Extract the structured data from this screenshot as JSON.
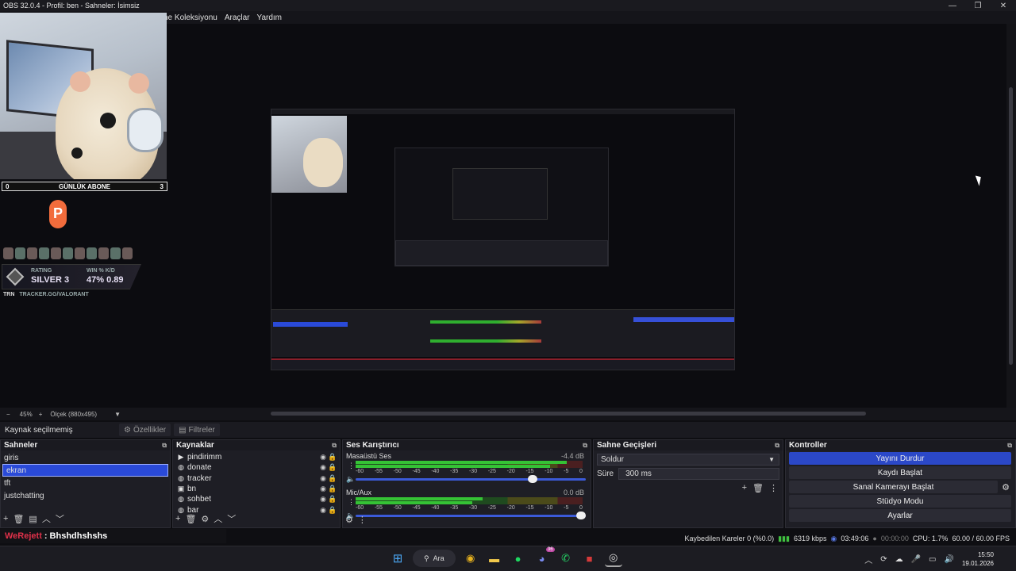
{
  "window": {
    "title": "OBS 32.0.4 - Profil: ben - Sahneler: İsimsiz",
    "controls": [
      "—",
      "❐",
      "✕"
    ]
  },
  "menu": [
    "ne Koleksiyonu",
    "Araçlar",
    "Yardım"
  ],
  "overlay": {
    "abone_left": "0",
    "abone_label": "GÜNLÜK ABONE",
    "abone_right": "3",
    "logo_letter": "P",
    "rating_label": "RATING",
    "rating_value": "SILVER 3",
    "winkd_label": "WIN % K/D",
    "winkd_value": "47% 0.89",
    "trn": "TRN",
    "tracker": "TRACKER.GG/VALORANT"
  },
  "zoom": {
    "minus": "−",
    "percent": "45%",
    "plus": "+",
    "scale_label": "Ölçek (880x495)",
    "caret": "▼"
  },
  "context": {
    "no_selection": "Kaynak seçilmemiş",
    "properties": "Özellikler",
    "filters": "Filtreler"
  },
  "scenes": {
    "header": "Sahneler",
    "items": [
      "giris",
      "ekran",
      "tft",
      "justchatting"
    ],
    "selected_index": 1
  },
  "sources": {
    "header": "Kaynaklar",
    "items": [
      {
        "name": "pindirimm",
        "icon": "play-icon"
      },
      {
        "name": "donate",
        "icon": "globe-icon"
      },
      {
        "name": "tracker",
        "icon": "globe-icon"
      },
      {
        "name": "bn",
        "icon": "image-icon"
      },
      {
        "name": "sohbet",
        "icon": "globe-icon"
      },
      {
        "name": "bar",
        "icon": "globe-icon"
      }
    ]
  },
  "mixer": {
    "header": "Ses Karıştırıcı",
    "scale": [
      "-60",
      "-55",
      "-50",
      "-45",
      "-40",
      "-35",
      "-30",
      "-25",
      "-20",
      "-15",
      "-10",
      "-5",
      "0"
    ],
    "channels": [
      {
        "name": "Masaüstü Ses",
        "db": "-4.4 dB",
        "level": 0.93,
        "volume": 0.77
      },
      {
        "name": "Mic/Aux",
        "db": "0.0 dB",
        "level": 0.56,
        "volume": 0.98
      }
    ]
  },
  "transitions": {
    "header": "Sahne Geçişleri",
    "selected": "Soldur",
    "duration_label": "Süre",
    "duration_value": "300 ms"
  },
  "controls": {
    "header": "Kontroller",
    "stop_stream": "Yayını Durdur",
    "start_record": "Kaydı Başlat",
    "virtual_cam": "Sanal Kamerayı Başlat",
    "studio_mode": "Stüdyo Modu",
    "settings": "Ayarlar"
  },
  "chat": {
    "user": "WeRejett",
    "separator": ":",
    "message": "Bhshdhshshs"
  },
  "status": {
    "dropped": "Kaybedilen Kareler 0 (%0.0)",
    "kbps": "6319 kbps",
    "live_time": "03:49:06",
    "rec_time": "00:00:00",
    "cpu": "CPU: 1.7%",
    "fps": "60.00 / 60.00 FPS"
  },
  "taskbar": {
    "search": "Ara",
    "badge": "36",
    "time": "15:50",
    "date": "19.01.2026"
  },
  "colors": {
    "accent": "#2b48c8",
    "meter_green": "#35c235",
    "chat_user": "#e0314a"
  }
}
